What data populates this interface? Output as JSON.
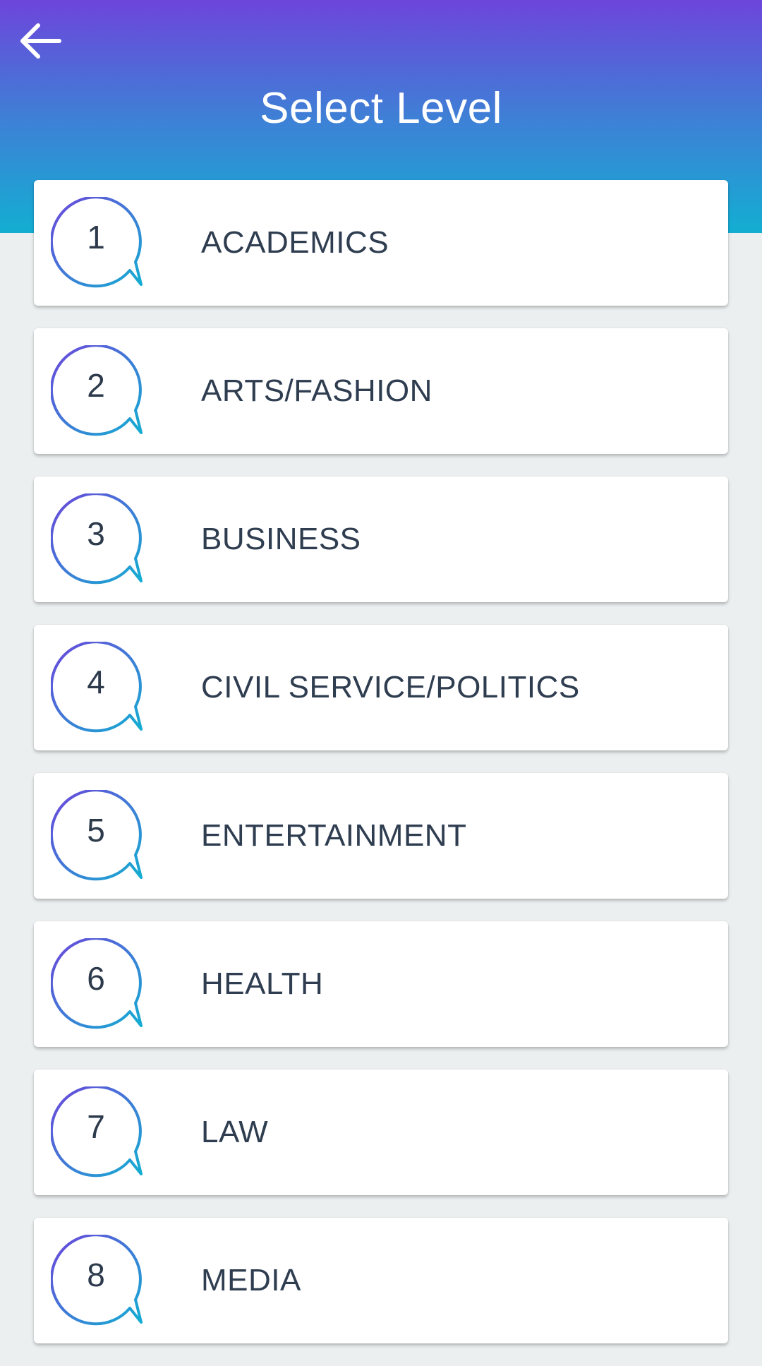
{
  "header": {
    "title": "Select Level",
    "back_icon": "arrow-left-icon",
    "gradient": [
      "#6d45db",
      "#3f7fd6",
      "#13aed2"
    ]
  },
  "levels": [
    {
      "number": "1",
      "label": "ACADEMICS"
    },
    {
      "number": "2",
      "label": "ARTS/FASHION"
    },
    {
      "number": "3",
      "label": "BUSINESS"
    },
    {
      "number": "4",
      "label": "CIVIL SERVICE/POLITICS"
    },
    {
      "number": "5",
      "label": "ENTERTAINMENT"
    },
    {
      "number": "6",
      "label": "HEALTH"
    },
    {
      "number": "7",
      "label": "LAW"
    },
    {
      "number": "8",
      "label": "MEDIA"
    }
  ],
  "icons": {
    "badge_icon": "speech-bubble-icon"
  },
  "colors": {
    "background": "#ebeff0",
    "text": "#2f3d50",
    "bubble_gradient_start": "#6d45db",
    "bubble_gradient_end": "#13aed2"
  }
}
